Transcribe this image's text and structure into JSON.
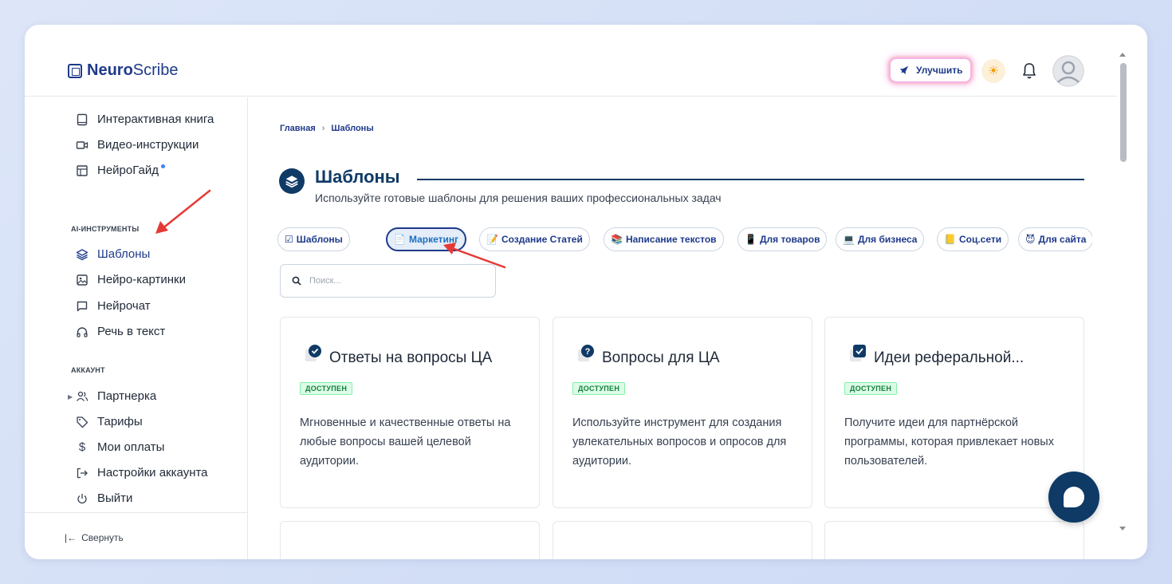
{
  "app": {
    "logo_bold": "Neuro",
    "logo_light": "Scribe",
    "upgrade_label": "Улучшить"
  },
  "sidebar": {
    "top_items": [
      {
        "label": "Интерактивная книга",
        "icon": "book-icon"
      },
      {
        "label": "Видео-инструкции",
        "icon": "video-icon"
      },
      {
        "label": "НейроГайд",
        "icon": "layout-icon"
      }
    ],
    "ai_section_title": "AI-ИНСТРУМЕНТЫ",
    "ai_items": [
      {
        "label": "Шаблоны",
        "icon": "layers-icon",
        "active": true
      },
      {
        "label": "Нейро-картинки",
        "icon": "image-icon"
      },
      {
        "label": "Нейрочат",
        "icon": "chat-icon"
      },
      {
        "label": "Речь в текст",
        "icon": "headphones-icon"
      }
    ],
    "account_section_title": "АККАУНТ",
    "account_items": [
      {
        "label": "Партнерка",
        "icon": "users-icon"
      },
      {
        "label": "Тарифы",
        "icon": "tag-icon"
      },
      {
        "label": "Мои оплаты",
        "icon": "dollar-icon"
      },
      {
        "label": "Настройки аккаунта",
        "icon": "login-icon"
      },
      {
        "label": "Выйти",
        "icon": "power-icon"
      }
    ],
    "collapse_label": "Свернуть"
  },
  "breadcrumb": {
    "home": "Главная",
    "current": "Шаблоны"
  },
  "page": {
    "title": "Шаблоны",
    "subtitle": "Используйте готовые шаблоны для решения ваших профессиональных задач"
  },
  "chips": [
    {
      "label": "Шаблоны",
      "emoji": "☑"
    },
    {
      "label": "Маркетинг",
      "emoji": "📄",
      "active": true
    },
    {
      "label": "Создание Статей",
      "emoji": "📝"
    },
    {
      "label": "Написание текстов",
      "emoji": "📚"
    },
    {
      "label": "Для товаров",
      "emoji": "📱"
    },
    {
      "label": "Для бизнеса",
      "emoji": "💻"
    },
    {
      "label": "Соц.сети",
      "emoji": "📒"
    },
    {
      "label": "Для сайта",
      "emoji": "😈"
    }
  ],
  "search": {
    "placeholder": "Поиск..."
  },
  "cards": [
    {
      "title": "Ответы на вопросы ЦА",
      "badge": "ДОСТУПЕН",
      "description": "Мгновенные и качественные ответы на любые вопросы вашей целевой аудитории.",
      "icon": "check-circle-icon"
    },
    {
      "title": "Вопросы для ЦА",
      "badge": "ДОСТУПЕН",
      "description": "Используйте инструмент для создания увлекательных вопросов и опросов для аудитории.",
      "icon": "question-circle-icon"
    },
    {
      "title": "Идеи реферальной...",
      "badge": "ДОСТУПЕН",
      "description": "Получите идеи для партнёрской программы, которая привлекает новых пользователей.",
      "icon": "check-box-icon"
    }
  ],
  "colors": {
    "brand": "#1e3a8a",
    "navy": "#0f3a66",
    "badge_green": "#15803d",
    "arrow_red": "#e53935"
  }
}
